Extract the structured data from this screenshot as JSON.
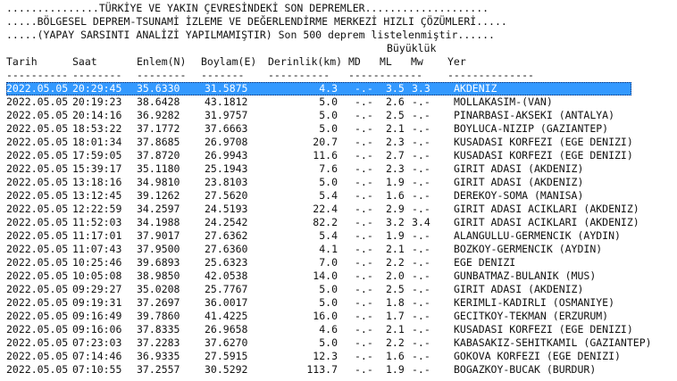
{
  "header": {
    "line1": "...............TÜRKİYE VE YAKIN ÇEVRESİNDEKİ SON DEPREMLER....................",
    "line2": ".....BÖLGESEL DEPREM-TSUNAMİ İZLEME VE DEĞERLENDİRME MERKEZİ HIZLI ÇÖZÜMLERİ.....",
    "line3": ".....(YAPAY SARSINTI ANALİZİ YAPILMAMIŞTIR) Son 500 deprem listelenmiştir......",
    "magnitude_group": "Büyüklük"
  },
  "columns": {
    "tarih": "Tarih",
    "saat": "Saat",
    "enlem": "Enlem(N)",
    "boylam": "Boylam(E)",
    "derinlik": "Derinlik(km)",
    "md": "MD",
    "ml": "ML",
    "mw": "Mw",
    "yer": "Yer"
  },
  "dashes": {
    "tarih": "----------",
    "saat": "--------",
    "enlem": "--------",
    "boylam": "-------",
    "derinlik": "----------",
    "md": "------------",
    "yer": "--------------"
  },
  "selected_row_index": 0,
  "rows": [
    {
      "tarih": "2022.05.05",
      "saat": "20:29:45",
      "enlem": "35.6330",
      "boylam": "31.5875",
      "derinlik": "4.3",
      "md": "-.-",
      "ml": "3.5",
      "mw": "3.3",
      "yer": "AKDENIZ"
    },
    {
      "tarih": "2022.05.05",
      "saat": "20:19:23",
      "enlem": "38.6428",
      "boylam": "43.1812",
      "derinlik": "5.0",
      "md": "-.-",
      "ml": "2.6",
      "mw": "-.-",
      "yer": "MOLLAKASIM-(VAN)"
    },
    {
      "tarih": "2022.05.05",
      "saat": "20:14:16",
      "enlem": "36.9282",
      "boylam": "31.9757",
      "derinlik": "5.0",
      "md": "-.-",
      "ml": "2.5",
      "mw": "-.-",
      "yer": "PINARBASI-AKSEKI (ANTALYA)"
    },
    {
      "tarih": "2022.05.05",
      "saat": "18:53:22",
      "enlem": "37.1772",
      "boylam": "37.6663",
      "derinlik": "5.0",
      "md": "-.-",
      "ml": "2.1",
      "mw": "-.-",
      "yer": "BOYLUCA-NIZIP (GAZIANTEP)"
    },
    {
      "tarih": "2022.05.05",
      "saat": "18:01:34",
      "enlem": "37.8685",
      "boylam": "26.9708",
      "derinlik": "20.7",
      "md": "-.-",
      "ml": "2.3",
      "mw": "-.-",
      "yer": "KUSADASI KORFEZI (EGE DENIZI)"
    },
    {
      "tarih": "2022.05.05",
      "saat": "17:59:05",
      "enlem": "37.8720",
      "boylam": "26.9943",
      "derinlik": "11.6",
      "md": "-.-",
      "ml": "2.7",
      "mw": "-.-",
      "yer": "KUSADASI KORFEZI (EGE DENIZI)"
    },
    {
      "tarih": "2022.05.05",
      "saat": "15:39:17",
      "enlem": "35.1180",
      "boylam": "25.1943",
      "derinlik": "7.6",
      "md": "-.-",
      "ml": "2.3",
      "mw": "-.-",
      "yer": "GIRIT ADASI (AKDENIZ)"
    },
    {
      "tarih": "2022.05.05",
      "saat": "13:18:16",
      "enlem": "34.9810",
      "boylam": "23.8103",
      "derinlik": "5.0",
      "md": "-.-",
      "ml": "1.9",
      "mw": "-.-",
      "yer": "GIRIT ADASI (AKDENIZ)"
    },
    {
      "tarih": "2022.05.05",
      "saat": "13:12:45",
      "enlem": "39.1262",
      "boylam": "27.5620",
      "derinlik": "5.4",
      "md": "-.-",
      "ml": "1.6",
      "mw": "-.-",
      "yer": "DEREKOY-SOMA (MANISA)"
    },
    {
      "tarih": "2022.05.05",
      "saat": "12:22:59",
      "enlem": "34.2597",
      "boylam": "24.5193",
      "derinlik": "22.4",
      "md": "-.-",
      "ml": "2.9",
      "mw": "-.-",
      "yer": "GIRIT ADASI ACIKLARI (AKDENIZ)"
    },
    {
      "tarih": "2022.05.05",
      "saat": "11:52:03",
      "enlem": "34.1988",
      "boylam": "24.2542",
      "derinlik": "82.2",
      "md": "-.-",
      "ml": "3.2",
      "mw": "3.4",
      "yer": "GIRIT ADASI ACIKLARI (AKDENIZ)"
    },
    {
      "tarih": "2022.05.05",
      "saat": "11:17:01",
      "enlem": "37.9017",
      "boylam": "27.6362",
      "derinlik": "5.4",
      "md": "-.-",
      "ml": "1.9",
      "mw": "-.-",
      "yer": "ALANGULLU-GERMENCIK (AYDIN)"
    },
    {
      "tarih": "2022.05.05",
      "saat": "11:07:43",
      "enlem": "37.9500",
      "boylam": "27.6360",
      "derinlik": "4.1",
      "md": "-.-",
      "ml": "2.1",
      "mw": "-.-",
      "yer": "BOZKOY-GERMENCIK (AYDIN)"
    },
    {
      "tarih": "2022.05.05",
      "saat": "10:25:46",
      "enlem": "39.6893",
      "boylam": "25.6323",
      "derinlik": "7.0",
      "md": "-.-",
      "ml": "2.2",
      "mw": "-.-",
      "yer": "EGE DENIZI"
    },
    {
      "tarih": "2022.05.05",
      "saat": "10:05:08",
      "enlem": "38.9850",
      "boylam": "42.0538",
      "derinlik": "14.0",
      "md": "-.-",
      "ml": "2.0",
      "mw": "-.-",
      "yer": "GUNBATMAZ-BULANIK (MUS)"
    },
    {
      "tarih": "2022.05.05",
      "saat": "09:29:27",
      "enlem": "35.0208",
      "boylam": "25.7767",
      "derinlik": "5.0",
      "md": "-.-",
      "ml": "2.5",
      "mw": "-.-",
      "yer": "GIRIT ADASI (AKDENIZ)"
    },
    {
      "tarih": "2022.05.05",
      "saat": "09:19:31",
      "enlem": "37.2697",
      "boylam": "36.0017",
      "derinlik": "5.0",
      "md": "-.-",
      "ml": "1.8",
      "mw": "-.-",
      "yer": "KERIMLI-KADIRLI (OSMANIYE)"
    },
    {
      "tarih": "2022.05.05",
      "saat": "09:16:49",
      "enlem": "39.7860",
      "boylam": "41.4225",
      "derinlik": "16.0",
      "md": "-.-",
      "ml": "1.7",
      "mw": "-.-",
      "yer": "GECITKOY-TEKMAN (ERZURUM)"
    },
    {
      "tarih": "2022.05.05",
      "saat": "09:16:06",
      "enlem": "37.8335",
      "boylam": "26.9658",
      "derinlik": "4.6",
      "md": "-.-",
      "ml": "2.1",
      "mw": "-.-",
      "yer": "KUSADASI KORFEZI (EGE DENIZI)"
    },
    {
      "tarih": "2022.05.05",
      "saat": "07:23:03",
      "enlem": "37.2283",
      "boylam": "37.6270",
      "derinlik": "5.0",
      "md": "-.-",
      "ml": "2.2",
      "mw": "-.-",
      "yer": "KABASAKIZ-SEHITKAMIL (GAZIANTEP)"
    },
    {
      "tarih": "2022.05.05",
      "saat": "07:14:46",
      "enlem": "36.9335",
      "boylam": "27.5915",
      "derinlik": "12.3",
      "md": "-.-",
      "ml": "1.6",
      "mw": "-.-",
      "yer": "GOKOVA KORFEZI (EGE DENIZI)"
    },
    {
      "tarih": "2022.05.05",
      "saat": "07:10:55",
      "enlem": "37.2557",
      "boylam": "30.5292",
      "derinlik": "113.7",
      "md": "-.-",
      "ml": "1.9",
      "mw": "-.-",
      "yer": "BOGAZKOY-BUCAK (BURDUR)"
    }
  ]
}
